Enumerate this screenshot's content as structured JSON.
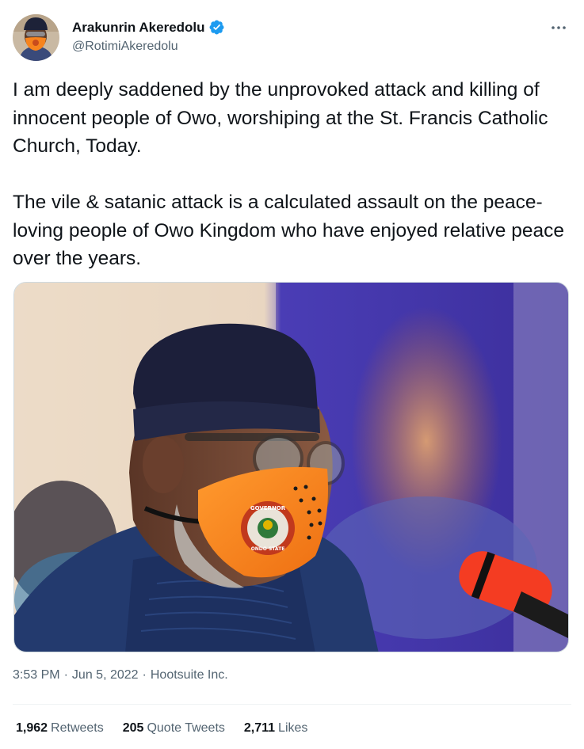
{
  "author": {
    "display_name": "Arakunrin Akeredolu",
    "handle": "@RotimiAkeredolu",
    "verified": true
  },
  "tweet": {
    "paragraphs": [
      "I am deeply saddened by the unprovoked attack and killing of innocent people of Owo, worshiping at the St. Francis Catholic Church, Today.",
      "The vile & satanic attack is a calculated assault on the peace-loving people of Owo Kingdom who have enjoyed relative peace over the years."
    ]
  },
  "media": {
    "mask_text_top": "GOVERNOR",
    "mask_text_bottom": "ONDO STATE"
  },
  "meta": {
    "time": "3:53 PM",
    "date": "Jun 5, 2022",
    "source": "Hootsuite Inc.",
    "separator": "·"
  },
  "stats": [
    {
      "count": "1,962",
      "label": "Retweets"
    },
    {
      "count": "205",
      "label": "Quote Tweets"
    },
    {
      "count": "2,711",
      "label": "Likes"
    }
  ],
  "colors": {
    "text_primary": "#0f1419",
    "text_secondary": "#536471",
    "verified": "#1d9bf0",
    "mask_orange": "#f7841e"
  },
  "icons": {
    "verified": "verified-badge-icon",
    "more": "more-horizontal-icon"
  }
}
